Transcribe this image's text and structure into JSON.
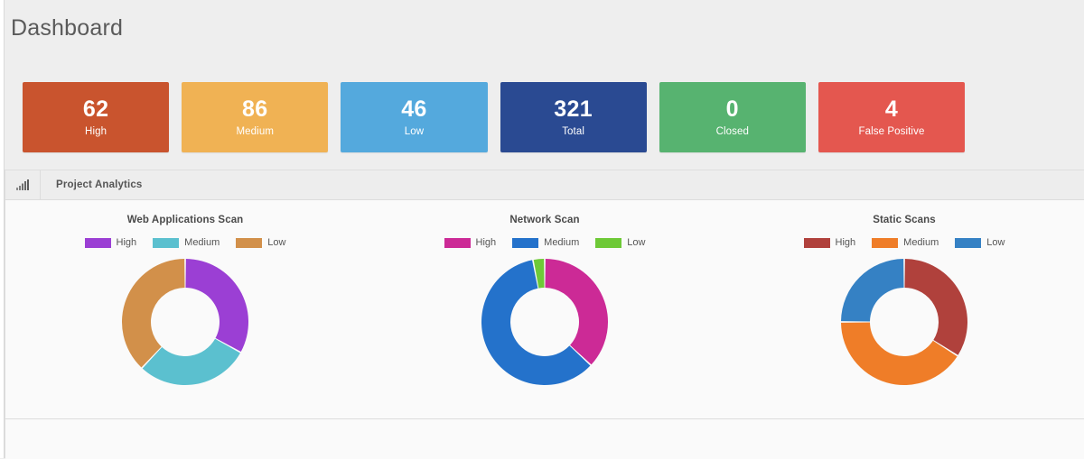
{
  "page": {
    "title": "Dashboard"
  },
  "stats": {
    "cards": [
      {
        "value": "62",
        "label": "High",
        "color": "#c9542e"
      },
      {
        "value": "86",
        "label": "Medium",
        "color": "#f0b254"
      },
      {
        "value": "46",
        "label": "Low",
        "color": "#54a9dd"
      },
      {
        "value": "321",
        "label": "Total",
        "color": "#2a4a92"
      },
      {
        "value": "0",
        "label": "Closed",
        "color": "#57b370"
      },
      {
        "value": "4",
        "label": "False Positive",
        "color": "#e4574f"
      }
    ]
  },
  "panel": {
    "icon": "bar-chart-icon",
    "title": "Project Analytics"
  },
  "chart_data": [
    {
      "type": "pie",
      "variant": "donut",
      "title": "Web Applications Scan",
      "categories": [
        "High",
        "Medium",
        "Low"
      ],
      "values": [
        33,
        29,
        38
      ],
      "colors": [
        "#9b3fd4",
        "#5bc0cf",
        "#d2904a"
      ],
      "legend_position": "top",
      "xlabel": "",
      "ylabel": ""
    },
    {
      "type": "pie",
      "variant": "donut",
      "title": "Network Scan",
      "categories": [
        "High",
        "Medium",
        "Low"
      ],
      "values": [
        37,
        60,
        3
      ],
      "colors": [
        "#cc2a96",
        "#2472cb",
        "#6ec937"
      ],
      "legend_position": "top",
      "xlabel": "",
      "ylabel": ""
    },
    {
      "type": "pie",
      "variant": "donut",
      "title": "Static Scans",
      "categories": [
        "High",
        "Medium",
        "Low"
      ],
      "values": [
        34,
        41,
        25
      ],
      "colors": [
        "#b0413c",
        "#ef7d28",
        "#3581c4"
      ],
      "legend_position": "top",
      "xlabel": "",
      "ylabel": ""
    }
  ]
}
